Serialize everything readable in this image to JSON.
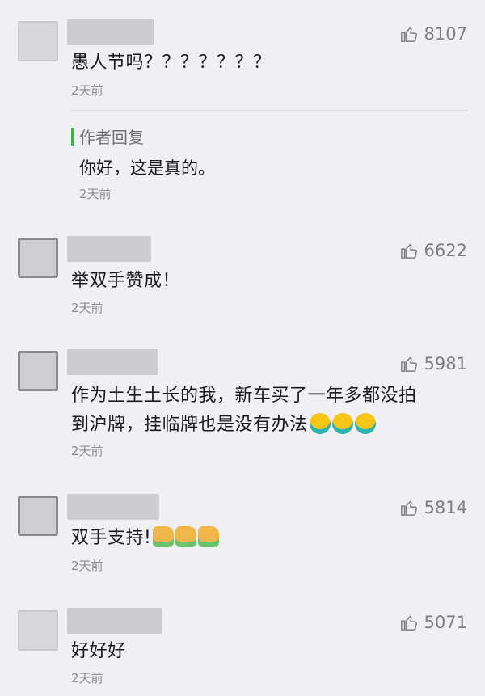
{
  "comments": [
    {
      "likes": "8107",
      "text": "愚人节吗？？？？？？？",
      "time": "2天前",
      "reply": {
        "label": "作者回复",
        "text": "你好，这是真的。",
        "time": "2天前"
      }
    },
    {
      "likes": "6622",
      "text": "举双手赞成！",
      "time": "2天前"
    },
    {
      "likes": "5981",
      "text_line1": "作为土生土长的我，新车买了一年多都没拍",
      "text_line2": "到沪牌，挂临牌也是没有办法",
      "emoji": "crying-face-icon",
      "time": "2天前"
    },
    {
      "likes": "5814",
      "text": "双手支持!",
      "emoji": "thumbs-up-icon",
      "time": "2天前"
    },
    {
      "likes": "5071",
      "text": "好好好",
      "time": "2天前"
    }
  ],
  "colors": {
    "accent": "#3ab54a",
    "muted": "#8a8a8f",
    "background": "#efeff4"
  }
}
